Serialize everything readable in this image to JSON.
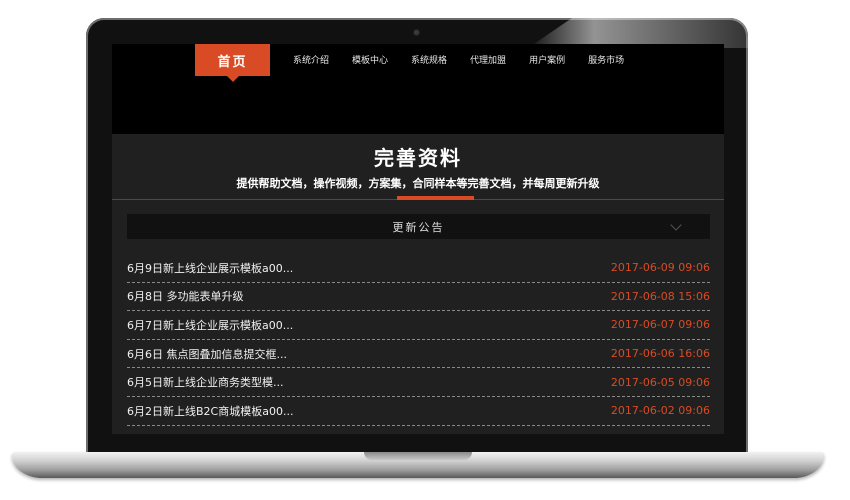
{
  "nav": {
    "home_label": "首页",
    "items": [
      "系统介绍",
      "模板中心",
      "系统规格",
      "代理加盟",
      "用户案例",
      "服务市场"
    ]
  },
  "hero": {
    "title": "完善资料",
    "subtitle": "提供帮助文档，操作视频，方案集，合同样本等完善文档，并每周更新升级"
  },
  "notice": {
    "header": "更新公告",
    "items": [
      {
        "title": "6月9日新上线企业展示模板a00...",
        "date": "2017-06-09 09:06"
      },
      {
        "title": "6月8日 多功能表单升级",
        "date": "2017-06-08 15:06"
      },
      {
        "title": "6月7日新上线企业展示模板a00...",
        "date": "2017-06-07 09:06"
      },
      {
        "title": "6月6日 焦点图叠加信息提交框...",
        "date": "2017-06-06 16:06"
      },
      {
        "title": "6月5日新上线企业商务类型模...",
        "date": "2017-06-05 09:06"
      },
      {
        "title": "6月2日新上线B2C商城模板a00...",
        "date": "2017-06-02 09:06"
      }
    ]
  },
  "colors": {
    "accent": "#d94b24",
    "background": "#202020",
    "topbar": "#000000"
  }
}
